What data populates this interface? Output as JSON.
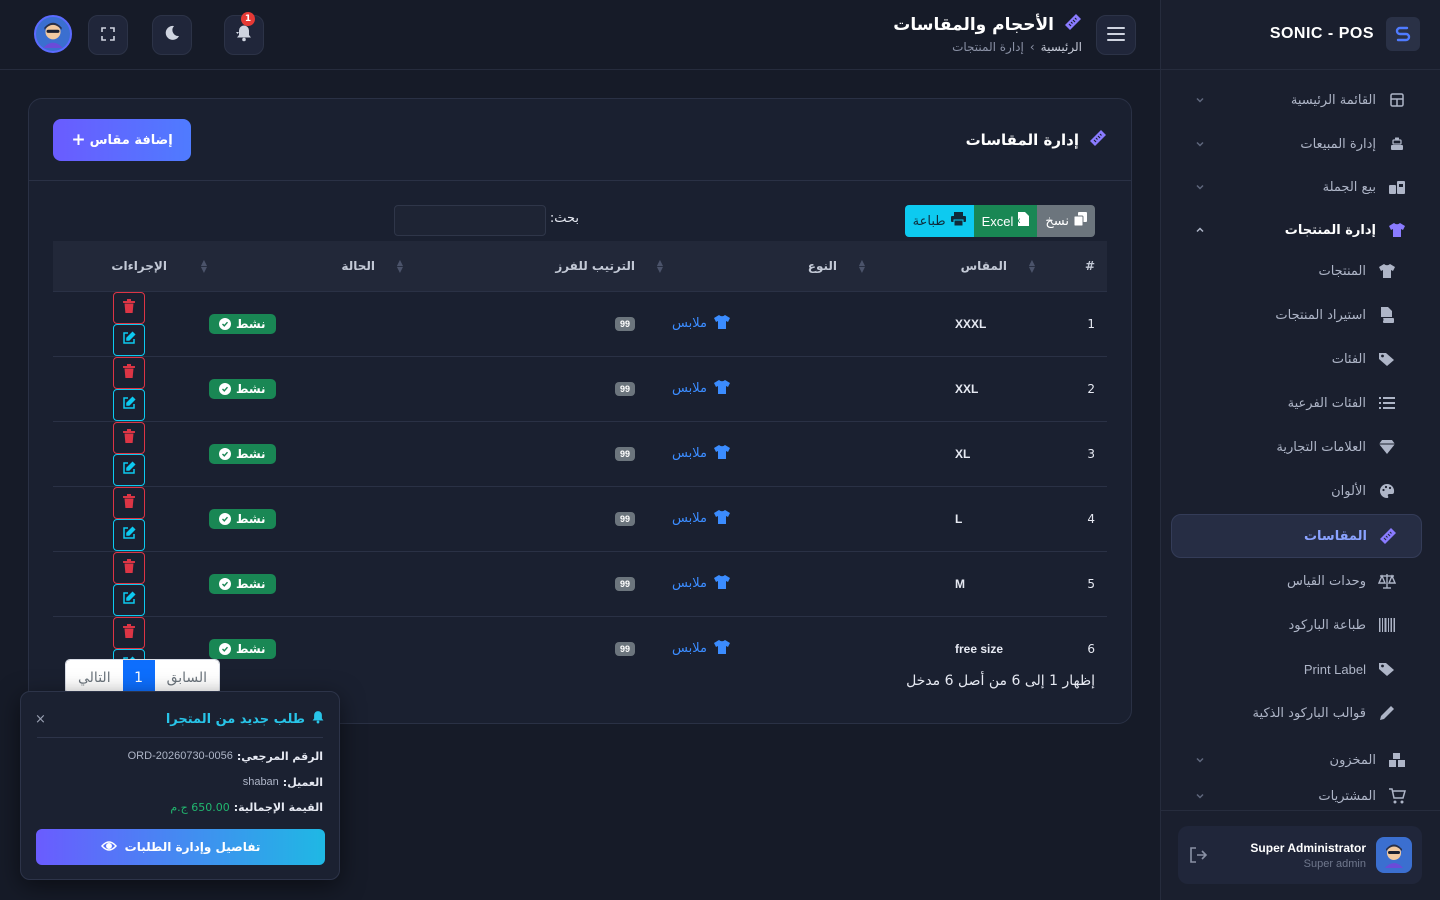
{
  "brand": {
    "name": "SONIC - POS"
  },
  "sidebar": {
    "items": [
      {
        "label": "القائمة الرئيسية",
        "icon": "dashboard-icon"
      },
      {
        "label": "إدارة المبيعات",
        "icon": "cash-register-icon"
      },
      {
        "label": "بيع الجملة",
        "icon": "warehouse-icon"
      },
      {
        "label": "إدارة المنتجات",
        "icon": "shirt-icon"
      }
    ],
    "sub_items": [
      {
        "label": "المنتجات",
        "icon": "shirt-icon"
      },
      {
        "label": "استيراد المنتجات",
        "icon": "csv-file-icon"
      },
      {
        "label": "الفئات",
        "icon": "tags-icon"
      },
      {
        "label": "الفئات الفرعية",
        "icon": "list-icon"
      },
      {
        "label": "العلامات التجارية",
        "icon": "gem-icon"
      },
      {
        "label": "الألوان",
        "icon": "palette-icon"
      },
      {
        "label": "المقاسات",
        "icon": "ruler-icon"
      },
      {
        "label": "وحدات القياس",
        "icon": "scale-icon"
      },
      {
        "label": "طباعة الباركود",
        "icon": "barcode-icon"
      },
      {
        "label": "Print Label",
        "icon": "tag-icon"
      },
      {
        "label": "قوالب الباركود الذكية",
        "icon": "pen-icon"
      }
    ],
    "bottom_items": [
      {
        "label": "المخزون",
        "icon": "boxes-icon"
      },
      {
        "label": "المشتريات",
        "icon": "cart-icon"
      }
    ],
    "user": {
      "name": "Super Administrator",
      "role": "Super admin"
    }
  },
  "header": {
    "title": "الأحجام والمقاسات",
    "breadcrumb_home": "الرئيسية",
    "breadcrumb_sep": "›",
    "breadcrumb_current": "إدارة المنتجات",
    "notification_count": "1"
  },
  "card": {
    "title": "إدارة المقاسات",
    "add_label": "إضافة مقاس",
    "export": {
      "copy": "نسخ",
      "excel": "Excel",
      "print": "طباعة"
    },
    "search_label": "بحث:",
    "search_value": ""
  },
  "table": {
    "columns": [
      "#",
      "المقاس",
      "النوع",
      "الترتيب للفرز",
      "الحالة",
      "الإجراءات"
    ],
    "rows": [
      {
        "num": "1",
        "size": "XXXL",
        "type": "ملابس",
        "order": "99",
        "status": "نشط"
      },
      {
        "num": "2",
        "size": "XXL",
        "type": "ملابس",
        "order": "99",
        "status": "نشط"
      },
      {
        "num": "3",
        "size": "XL",
        "type": "ملابس",
        "order": "99",
        "status": "نشط"
      },
      {
        "num": "4",
        "size": "L",
        "type": "ملابس",
        "order": "99",
        "status": "نشط"
      },
      {
        "num": "5",
        "size": "M",
        "type": "ملابس",
        "order": "99",
        "status": "نشط"
      },
      {
        "num": "6",
        "size": "free size",
        "type": "ملابس",
        "order": "99",
        "status": "نشط"
      }
    ],
    "info": "إظهار 1 إلى 6 من أصل 6 مدخل",
    "pager": {
      "prev": "السابق",
      "current": "1",
      "next": "التالي"
    }
  },
  "toast": {
    "title": "طلب جديد من المتجرا",
    "ref_key": "الرقم المرجعي:",
    "ref_val": "ORD-20260730-0056",
    "customer_key": "العميل:",
    "customer_val": "shaban",
    "total_key": "القيمة الإجمالية:",
    "total_val": "650.00 ج.م",
    "button": "تفاصيل وإدارة الطلبات",
    "close": "×"
  },
  "colors": {
    "accent": "#6a5cff",
    "success": "#198754",
    "info": "#0dcaf0",
    "danger": "#dc3545",
    "link": "#3b8cff"
  }
}
